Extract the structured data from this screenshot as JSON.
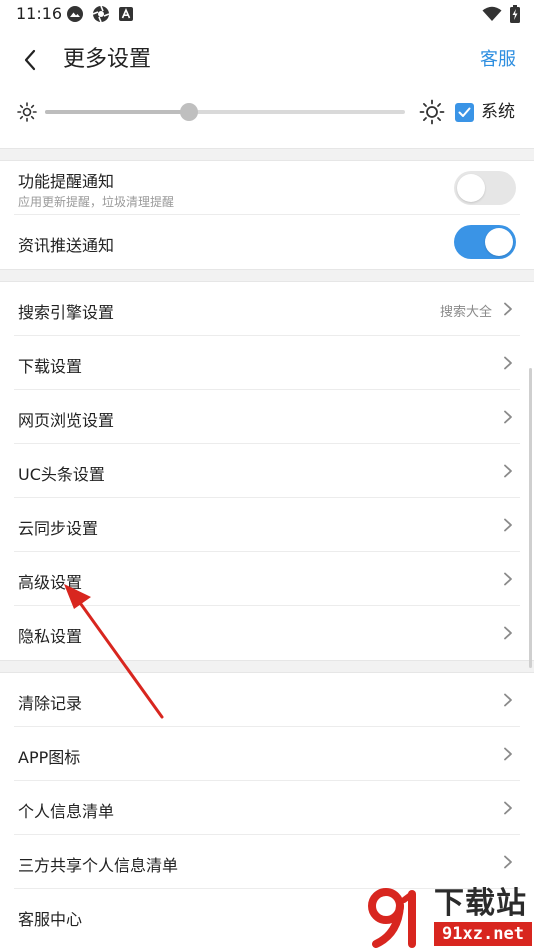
{
  "status_bar": {
    "time": "11:16",
    "left_icons": [
      "gallery-icon",
      "aperture-icon",
      "app-a-icon"
    ],
    "right_icons": [
      "wifi-icon",
      "battery-charging-icon"
    ]
  },
  "header": {
    "title": "更多设置",
    "back_icon": "chevron-left-icon",
    "support_label": "客服"
  },
  "brightness": {
    "level": 0.4,
    "system_checked": true,
    "system_label": "系统"
  },
  "notifications": [
    {
      "label": "功能提醒通知",
      "sublabel": "应用更新提醒，垃圾清理提醒",
      "on": false
    },
    {
      "label": "资讯推送通知",
      "on": true
    }
  ],
  "settings_group": [
    {
      "label": "搜索引擎设置",
      "value": "搜索大全"
    },
    {
      "label": "下载设置"
    },
    {
      "label": "网页浏览设置"
    },
    {
      "label": "UC头条设置"
    },
    {
      "label": "云同步设置"
    },
    {
      "label": "高级设置"
    },
    {
      "label": "隐私设置"
    }
  ],
  "other_group": [
    {
      "label": "清除记录"
    },
    {
      "label": "APP图标"
    },
    {
      "label": "个人信息清单"
    },
    {
      "label": "三方共享个人信息清单"
    },
    {
      "label": "客服中心"
    }
  ],
  "watermark": {
    "title": "下载站",
    "domain": "91xz.net"
  },
  "colors": {
    "accent": "#3a94e6",
    "link": "#2f8fe0",
    "annotation_arrow": "#d8261f"
  }
}
